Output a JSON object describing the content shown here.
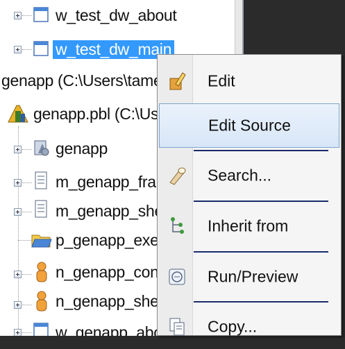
{
  "tree": {
    "items": [
      {
        "label": "w_test_dw_about"
      },
      {
        "label": "w_test_dw_main"
      },
      {
        "label": "genapp (C:\\Users\\tamer\\"
      },
      {
        "label": "genapp.pbl (C:\\Users\\"
      },
      {
        "label": "genapp"
      },
      {
        "label": "m_genapp_frame"
      },
      {
        "label": "m_genapp_sheet"
      },
      {
        "label": "p_genapp_exe"
      },
      {
        "label": "n_genapp_conne"
      },
      {
        "label": "n_genapp_sheet"
      },
      {
        "label": "w_genapp_about"
      }
    ]
  },
  "context_menu": {
    "items": [
      {
        "label": "Edit",
        "icon": "pencil-edit-icon"
      },
      {
        "label": "Edit Source",
        "icon": "none"
      },
      {
        "label": "Search...",
        "icon": "flashlight-search-icon"
      },
      {
        "label": "Inherit from",
        "icon": "inherit-tree-icon"
      },
      {
        "label": "Run/Preview",
        "icon": "run-preview-icon"
      },
      {
        "label": "Copy...",
        "icon": "copy-icon"
      }
    ],
    "highlighted": "Edit Source"
  },
  "colors": {
    "selection": "#3399ff",
    "menu_highlight": "#d7e6f7",
    "separator": "#1a2a6b"
  }
}
